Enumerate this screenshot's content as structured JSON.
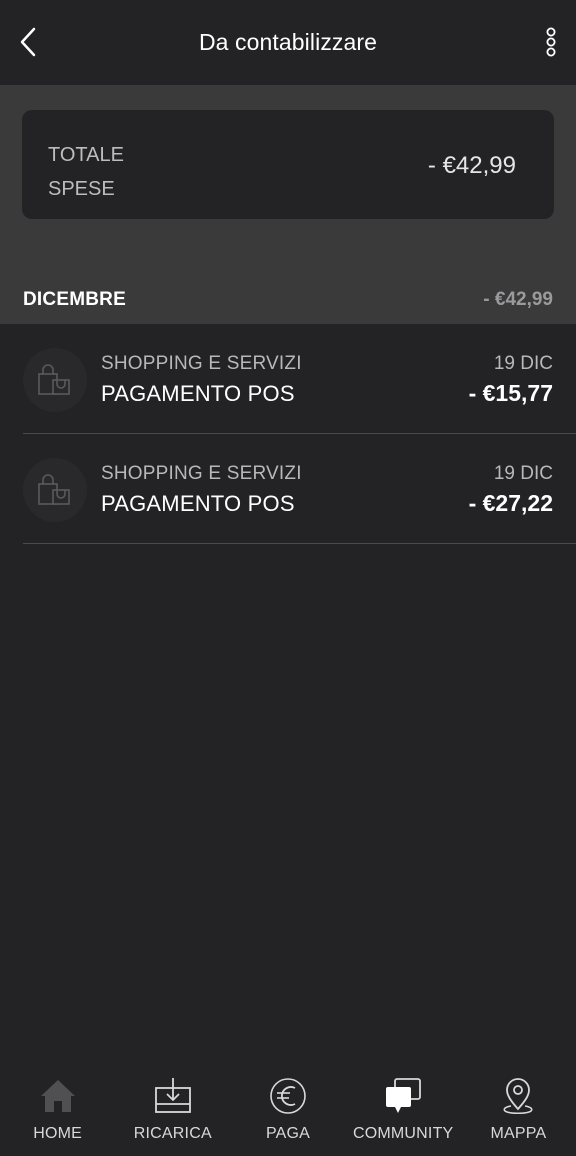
{
  "header": {
    "title": "Da contabilizzare",
    "back_icon": "back-chevron-icon",
    "more_icon": "more-vertical-icon"
  },
  "summary": {
    "label": "TOTALE SPESE",
    "amount": "- €42,99"
  },
  "month": {
    "name": "DICEMBRE",
    "total": "- €42,99"
  },
  "transactions": [
    {
      "icon": "shopping-bag-icon",
      "category": "SHOPPING E SERVIZI",
      "title": "PAGAMENTO POS",
      "date": "19 DIC",
      "amount": "- €15,77"
    },
    {
      "icon": "shopping-bag-icon",
      "category": "SHOPPING E SERVIZI",
      "title": "PAGAMENTO POS",
      "date": "19 DIC",
      "amount": "- €27,22"
    }
  ],
  "nav": [
    {
      "label": "HOME",
      "icon": "home-icon"
    },
    {
      "label": "RICARICA",
      "icon": "top-up-icon"
    },
    {
      "label": "PAGA",
      "icon": "euro-icon"
    },
    {
      "label": "COMMUNITY",
      "icon": "chat-bubbles-icon"
    },
    {
      "label": "MAPPA",
      "icon": "map-pin-icon"
    }
  ],
  "colors": {
    "background": "#232325",
    "summary_background": "#3a3a3b",
    "card_background": "#232325",
    "text_primary": "#ffffff",
    "text_secondary": "#b8b8ba",
    "divider": "#4a4a4c"
  }
}
